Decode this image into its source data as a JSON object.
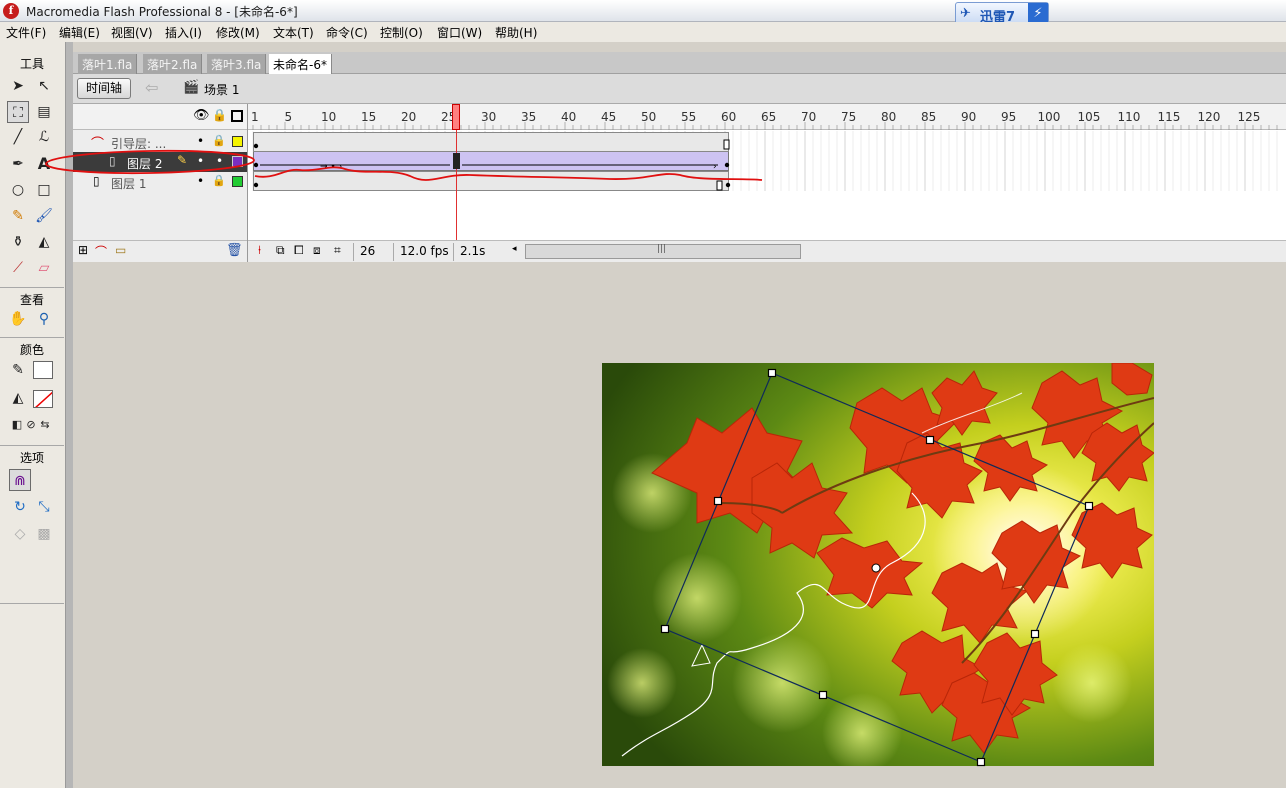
{
  "window": {
    "title": "Macromedia Flash Professional 8 - [未命名-6*]",
    "app_icon_glyph": "f",
    "xunlei_label": "迅雷7",
    "xunlei_bolt": "⚡"
  },
  "menu": {
    "items": [
      "文件(F)",
      "编辑(E)",
      "视图(V)",
      "插入(I)",
      "修改(M)",
      "文本(T)",
      "命令(C)",
      "控制(O)",
      "窗口(W)",
      "帮助(H)"
    ]
  },
  "toolbox": {
    "tools_heading": "工具",
    "view_heading": "查看",
    "colors_heading": "颜色",
    "options_heading": "选项"
  },
  "tabs": [
    "落叶1.fla",
    "落叶2.fla",
    "落叶3.fla",
    "未命名-6*"
  ],
  "edit_bar": {
    "timeline_button": "时间轴",
    "scene_label": "场景 1"
  },
  "timeline": {
    "ruler_ticks": [
      "1",
      "5",
      "10",
      "15",
      "20",
      "25",
      "30",
      "35",
      "40",
      "45",
      "50",
      "55",
      "60",
      "65",
      "70",
      "75",
      "80",
      "85",
      "90",
      "95",
      "100",
      "105",
      "110",
      "115",
      "120",
      "125"
    ],
    "playhead_frame": 26,
    "total_frames": 60,
    "layers": [
      {
        "name": "引导层: ...",
        "type": "guide",
        "color": "#f5f500"
      },
      {
        "name": "图层 2",
        "type": "normal",
        "color": "#7a2fc0",
        "selected": true
      },
      {
        "name": "图层 1",
        "type": "normal",
        "color": "#22cc33"
      }
    ],
    "status": {
      "current_frame": "26",
      "fps": "12.0 fps",
      "time": "2.1s"
    }
  },
  "colors": {
    "annotation_red": "#e01010",
    "selected_layer_bg": "#3b3b3b",
    "playhead": "#ff6060"
  }
}
